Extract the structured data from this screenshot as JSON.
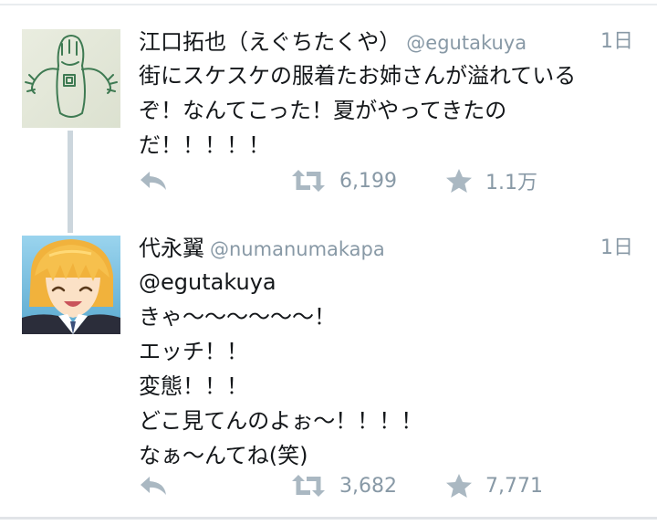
{
  "tweets": [
    {
      "display_name": "江口拓也（えぐちたくや）",
      "handle": "@egutakuya",
      "time": "1日",
      "text": "街にスケスケの服着たお姉さんが溢れている\nぞ！なんてこった！夏がやってきたの\nだ！！！！！",
      "actions": {
        "reply_icon": "reply-icon",
        "retweet_icon": "retweet-icon",
        "retweets": "6,199",
        "favorite_icon": "star-icon",
        "favorites": "1.1万"
      }
    },
    {
      "display_name": "代永翼",
      "handle": "@numanumakapa",
      "time": "1日",
      "text": "@egutakuya\nきゃ～～～～～～！\nエッチ！！\n変態！！！\nどこ見てんのよぉ～！！！！\nなぁ～んてね(笑)",
      "actions": {
        "reply_icon": "reply-icon",
        "retweet_icon": "retweet-icon",
        "retweets": "3,682",
        "favorite_icon": "star-icon",
        "favorites": "7,771"
      }
    }
  ],
  "colors": {
    "text": "#14171a",
    "muted": "#8899a6",
    "icon": "#aab8c2",
    "thread": "#ccd6dd"
  }
}
